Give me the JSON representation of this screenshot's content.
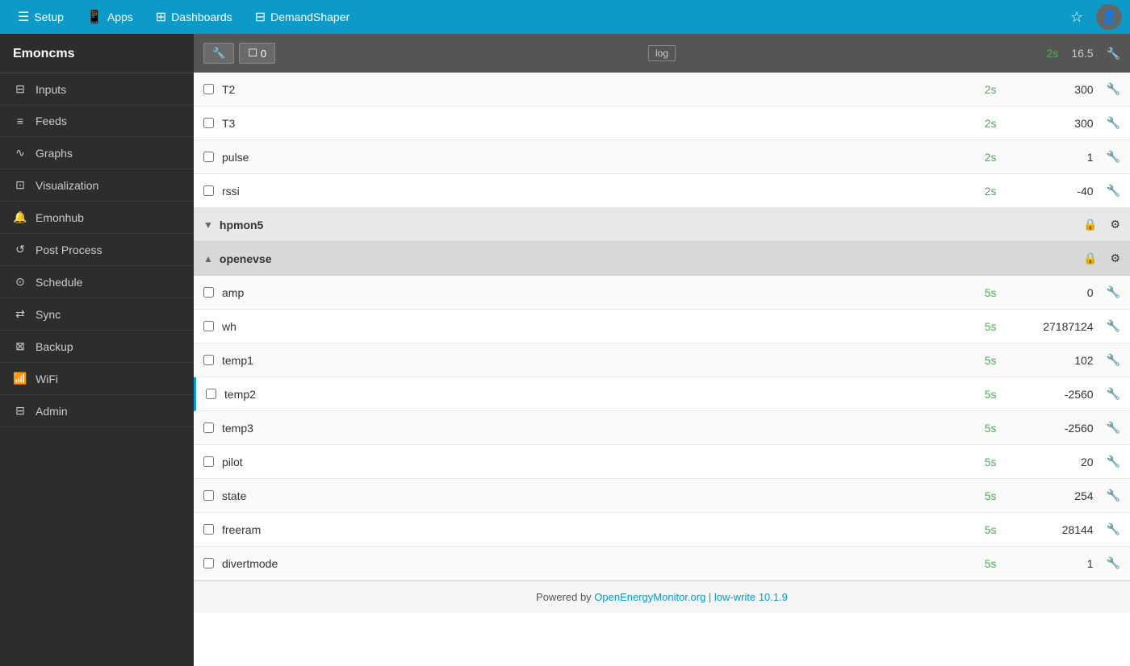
{
  "topnav": {
    "items": [
      {
        "label": "Setup",
        "icon": "☰",
        "name": "setup"
      },
      {
        "label": "Apps",
        "icon": "📱",
        "name": "apps"
      },
      {
        "label": "Dashboards",
        "icon": "⊞",
        "name": "dashboards"
      },
      {
        "label": "DemandShaper",
        "icon": "⊟",
        "name": "demandshaper"
      }
    ]
  },
  "sidebar": {
    "title": "Emoncms",
    "items": [
      {
        "label": "Inputs",
        "icon": "⊟",
        "name": "inputs"
      },
      {
        "label": "Feeds",
        "icon": "≡",
        "name": "feeds"
      },
      {
        "label": "Graphs",
        "icon": "∿",
        "name": "graphs"
      },
      {
        "label": "Visualization",
        "icon": "⊡",
        "name": "visualization"
      },
      {
        "label": "Emonhub",
        "icon": "🔔",
        "name": "emonhub"
      },
      {
        "label": "Post Process",
        "icon": "↺",
        "name": "post-process"
      },
      {
        "label": "Schedule",
        "icon": "⊙",
        "name": "schedule"
      },
      {
        "label": "Sync",
        "icon": "⇄",
        "name": "sync"
      },
      {
        "label": "Backup",
        "icon": "⊠",
        "name": "backup"
      },
      {
        "label": "WiFi",
        "icon": "📶",
        "name": "wifi"
      },
      {
        "label": "Admin",
        "icon": "⊟",
        "name": "admin"
      }
    ]
  },
  "toolbar": {
    "wrench_icon": "🔧",
    "box_count": "0",
    "log_label": "log",
    "interval": "2s",
    "value": "16.5"
  },
  "rows_top": [
    {
      "name": "T2",
      "interval": "2s",
      "value": "300"
    },
    {
      "name": "T3",
      "interval": "2s",
      "value": "300"
    },
    {
      "name": "pulse",
      "interval": "2s",
      "value": "1"
    },
    {
      "name": "rssi",
      "interval": "2s",
      "value": "-40"
    }
  ],
  "group_hpmon5": {
    "name": "hpmon5",
    "collapsed": true
  },
  "group_openevse": {
    "name": "openevse",
    "expanded": true
  },
  "rows_openevse": [
    {
      "name": "amp",
      "interval": "5s",
      "value": "0",
      "highlighted": false
    },
    {
      "name": "wh",
      "interval": "5s",
      "value": "27187124",
      "highlighted": false
    },
    {
      "name": "temp1",
      "interval": "5s",
      "value": "102",
      "highlighted": false
    },
    {
      "name": "temp2",
      "interval": "5s",
      "value": "-2560",
      "highlighted": true
    },
    {
      "name": "temp3",
      "interval": "5s",
      "value": "-2560",
      "highlighted": false
    },
    {
      "name": "pilot",
      "interval": "5s",
      "value": "20",
      "highlighted": false
    },
    {
      "name": "state",
      "interval": "5s",
      "value": "254",
      "highlighted": false
    },
    {
      "name": "freeram",
      "interval": "5s",
      "value": "28144",
      "highlighted": false
    },
    {
      "name": "divertmode",
      "interval": "5s",
      "value": "1",
      "highlighted": false
    }
  ],
  "footer": {
    "text": "Powered by ",
    "link_text": "OpenEnergyMonitor.org | low-write 10.1.9",
    "link_url": "#"
  }
}
